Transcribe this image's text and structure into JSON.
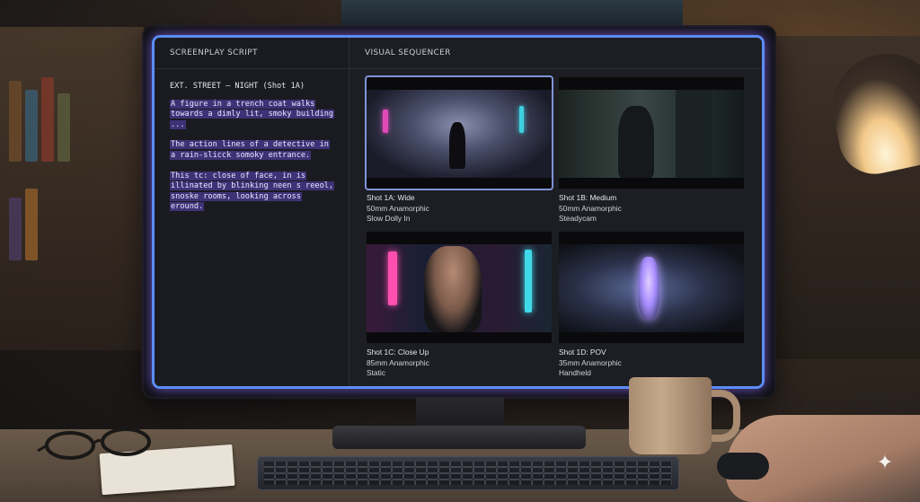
{
  "script_panel": {
    "header": "SCREENPLAY SCRIPT",
    "slugline": "EXT. STREET – NIGHT (Shot 1A)",
    "paragraphs": [
      "A figure in a trench coat walks towards a dimly lit, smoky building ...",
      "The action lines of a detective in a rain-slicck somoky entrance.",
      "This tc: close of face, in is illinated by blinking neen s reeol, snoske rooms, looking across eround."
    ]
  },
  "sequencer": {
    "header": "VISUAL SEQUENCER",
    "shots": [
      {
        "title": "Shot 1A: Wide",
        "lens": "50mm Anamorphic",
        "move": "Slow Dolly In",
        "selected": true,
        "thumbnail_icon": "street-scene"
      },
      {
        "title": "Shot 1B: Medium",
        "lens": "50mm Anamorphic",
        "move": "Steadycam",
        "selected": false,
        "thumbnail_icon": "doorway-scene"
      },
      {
        "title": "Shot 1C: Close Up",
        "lens": "85mm Anamorphic",
        "move": "Static",
        "selected": false,
        "thumbnail_icon": "face-scene"
      },
      {
        "title": "Shot 1D: POV",
        "lens": "35mm Anamorphic",
        "move": "Handheld",
        "selected": false,
        "thumbnail_icon": "hologram-scene"
      }
    ]
  },
  "colors": {
    "screen_glow": "#7a5cf0",
    "highlight": "#5c46be",
    "selected_outline": "#7f94d8"
  }
}
